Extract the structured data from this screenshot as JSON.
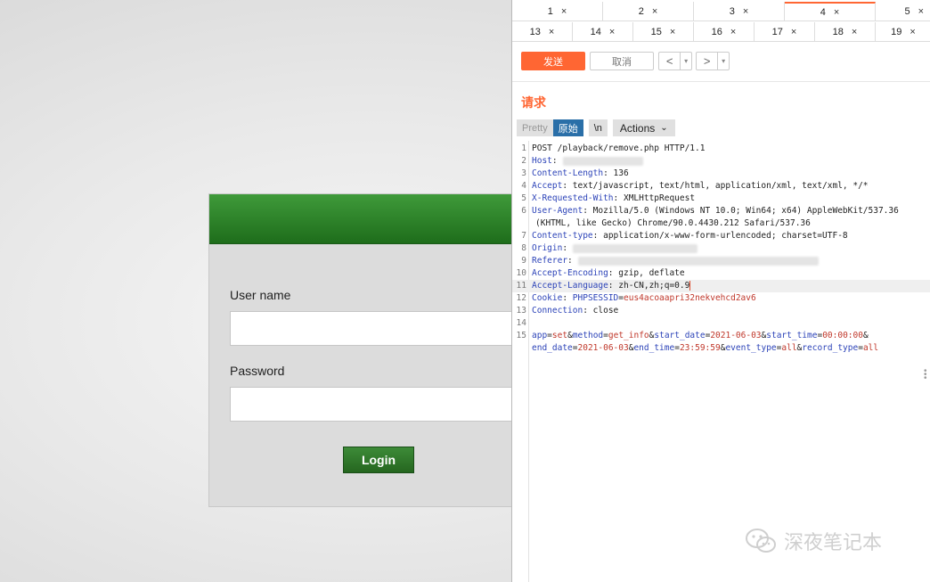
{
  "login": {
    "username_label": "User name",
    "password_label": "Password",
    "username_value": "",
    "password_value": "",
    "login_label": "Login"
  },
  "tabs_row1": [
    {
      "label": "1"
    },
    {
      "label": "2"
    },
    {
      "label": "3"
    },
    {
      "label": "4"
    },
    {
      "label": "5"
    }
  ],
  "tabs_row2": [
    {
      "label": "13"
    },
    {
      "label": "14"
    },
    {
      "label": "15"
    },
    {
      "label": "16"
    },
    {
      "label": "17"
    },
    {
      "label": "18"
    },
    {
      "label": "19"
    }
  ],
  "tab_close_glyph": "×",
  "toolbar": {
    "send_label": "发送",
    "cancel_label": "取消",
    "back_glyph": "<",
    "forward_glyph": ">",
    "dropdown_glyph": "▾"
  },
  "request": {
    "title": "请求",
    "view_pretty": "Pretty",
    "view_raw": "原始",
    "view_newline": "\\n",
    "actions_label": "Actions"
  },
  "code": {
    "line_numbers": [
      "1",
      "2",
      "3",
      "4",
      "5",
      "6",
      "",
      "7",
      "8",
      "9",
      "10",
      "11",
      "12",
      "13",
      "14",
      "15",
      ""
    ],
    "l1": "POST /playback/remove.php HTTP/1.1",
    "host_key": "Host",
    "cl_key": "Content-Length",
    "cl_val": "136",
    "accept_key": "Accept",
    "accept_val": "text/javascript, text/html, application/xml, text/xml, */*",
    "xrw_key": "X-Requested-With",
    "xrw_val": "XMLHttpRequest",
    "ua_key": "User-Agent",
    "ua_val": "Mozilla/5.0 (Windows NT 10.0; Win64; x64) AppleWebKit/537.36",
    "ua_val2": "(KHTML, like Gecko) Chrome/90.0.4430.212 Safari/537.36",
    "ct_key": "Content-type",
    "ct_val": "application/x-www-form-urlencoded; charset=UTF-8",
    "origin_key": "Origin",
    "referer_key": "Referer",
    "ae_key": "Accept-Encoding",
    "ae_val": "gzip, deflate",
    "al_key": "Accept-Language",
    "al_val": "zh-CN,zh;q=0.9",
    "cookie_key": "Cookie",
    "cookie_name": "PHPSESSID",
    "cookie_val": "eus4acoaapri32nekvehcd2av6",
    "conn_key": "Connection",
    "conn_val": "close",
    "body_params_1": [
      {
        "k": "app",
        "v": "set"
      },
      {
        "k": "method",
        "v": "get_info"
      },
      {
        "k": "start_date",
        "v": "2021-06-03"
      },
      {
        "k": "start_time",
        "v": "00:00:00"
      }
    ],
    "body_params_2": [
      {
        "k": "end_date",
        "v": "2021-06-03"
      },
      {
        "k": "end_time",
        "v": "23:59:59"
      },
      {
        "k": "event_type",
        "v": "all"
      },
      {
        "k": "record_type",
        "v": "all"
      }
    ]
  },
  "watermark": {
    "text": "深夜笔记本",
    "icon": "wechat-icon"
  },
  "colors": {
    "accent": "#ff6633",
    "login_green": "#2f7d2a",
    "header_key_blue": "#2c43b8",
    "param_value_red": "#c0382b",
    "raw_tab_blue": "#2a6fa8"
  }
}
